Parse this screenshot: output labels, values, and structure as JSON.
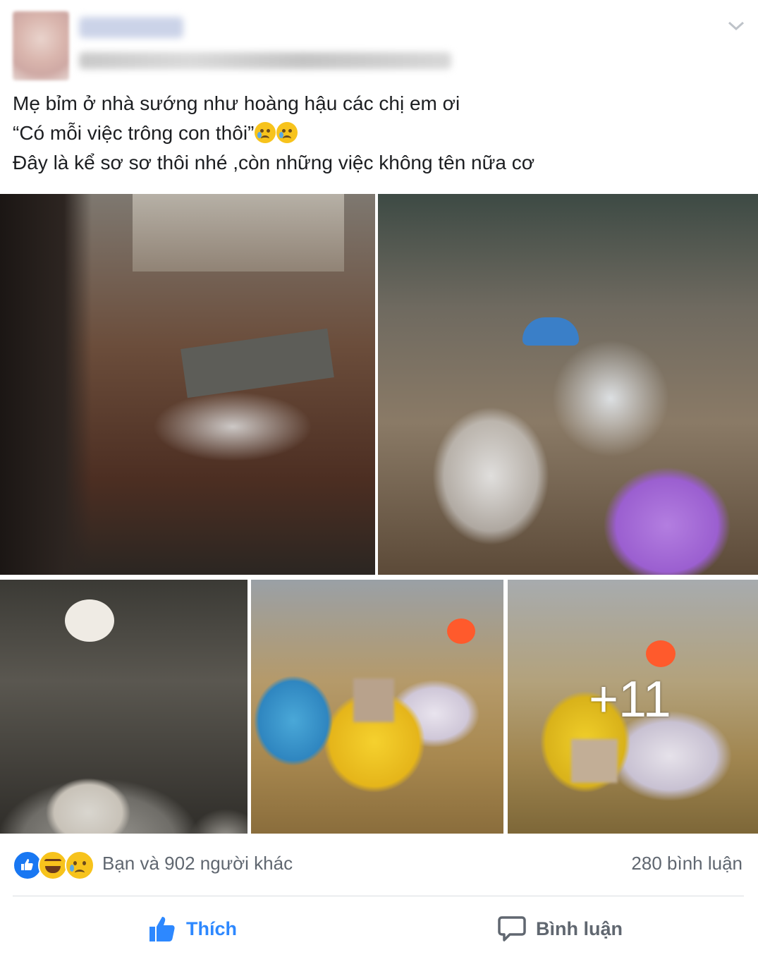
{
  "post": {
    "author_name": "",
    "text_lines": [
      "Mẹ bỉm ở nhà sướng như hoàng hậu các chị em ơi",
      "“Có mỗi việc trông con thôi”",
      "Đây là kể sơ sơ thôi nhé ,còn những việc không tên nữa cơ"
    ],
    "photos_more_count": "+11"
  },
  "reactions": {
    "icons": [
      "like-icon",
      "haha-icon",
      "sad-icon"
    ],
    "summary": "Bạn và 902 người khác",
    "comments_count": "280 bình luận"
  },
  "actions": {
    "like_label": "Thích",
    "comment_label": "Bình luận"
  },
  "colors": {
    "like_blue": "#2d88ff",
    "secondary_text": "#606770",
    "divider": "#dadde1"
  }
}
